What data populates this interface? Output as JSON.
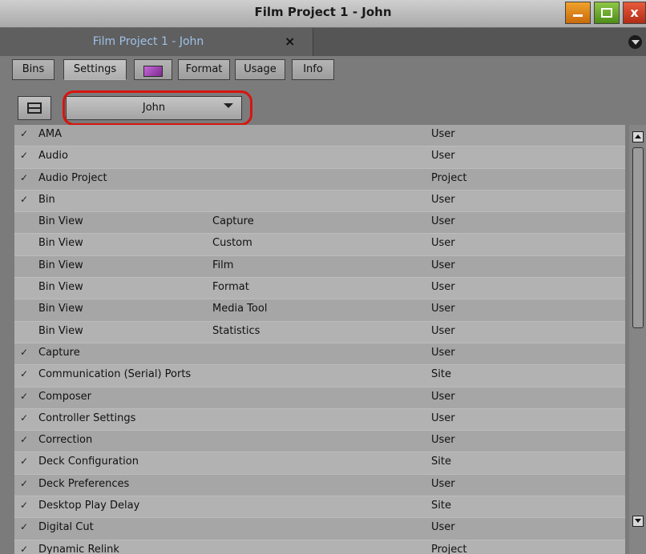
{
  "window": {
    "title": "Film Project 1 - John",
    "minimize_icon": "minimize-icon",
    "maximize_icon": "maximize-icon",
    "close_icon": "close-icon"
  },
  "doc_tab": {
    "label": "Film Project 1 - John",
    "close_symbol": "×"
  },
  "category_tabs": [
    {
      "label": "Bins"
    },
    {
      "label": "Settings",
      "active": true
    },
    {
      "label": "",
      "icon": "color-swatch-icon"
    },
    {
      "label": "Format"
    },
    {
      "label": "Usage"
    },
    {
      "label": "Info"
    }
  ],
  "toolbar": {
    "user_select_value": "John"
  },
  "settings": [
    {
      "check": "✓",
      "name": "AMA",
      "sub": "",
      "scope": "User"
    },
    {
      "check": "✓",
      "name": "Audio",
      "sub": "",
      "scope": "User"
    },
    {
      "check": "✓",
      "name": "Audio Project",
      "sub": "",
      "scope": "Project"
    },
    {
      "check": "✓",
      "name": "Bin",
      "sub": "",
      "scope": "User"
    },
    {
      "check": "",
      "name": "Bin View",
      "sub": "Capture",
      "scope": "User"
    },
    {
      "check": "",
      "name": "Bin View",
      "sub": "Custom",
      "scope": "User"
    },
    {
      "check": "",
      "name": "Bin View",
      "sub": "Film",
      "scope": "User"
    },
    {
      "check": "",
      "name": "Bin View",
      "sub": "Format",
      "scope": "User"
    },
    {
      "check": "",
      "name": "Bin View",
      "sub": "Media Tool",
      "scope": "User"
    },
    {
      "check": "",
      "name": "Bin View",
      "sub": "Statistics",
      "scope": "User"
    },
    {
      "check": "✓",
      "name": "Capture",
      "sub": "",
      "scope": "User"
    },
    {
      "check": "✓",
      "name": "Communication (Serial) Ports",
      "sub": "",
      "scope": "Site"
    },
    {
      "check": "✓",
      "name": "Composer",
      "sub": "",
      "scope": "User"
    },
    {
      "check": "✓",
      "name": "Controller Settings",
      "sub": "",
      "scope": "User"
    },
    {
      "check": "✓",
      "name": "Correction",
      "sub": "",
      "scope": "User"
    },
    {
      "check": "✓",
      "name": "Deck Configuration",
      "sub": "",
      "scope": "Site"
    },
    {
      "check": "✓",
      "name": "Deck Preferences",
      "sub": "",
      "scope": "User"
    },
    {
      "check": "✓",
      "name": "Desktop Play Delay",
      "sub": "",
      "scope": "Site"
    },
    {
      "check": "✓",
      "name": "Digital Cut",
      "sub": "",
      "scope": "User"
    },
    {
      "check": "✓",
      "name": "Dynamic Relink",
      "sub": "",
      "scope": "Project"
    }
  ]
}
